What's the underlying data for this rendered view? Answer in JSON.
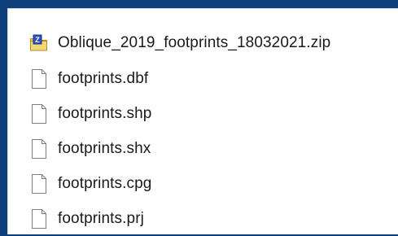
{
  "files": [
    {
      "name": "Oblique_2019_footprints_18032021.zip",
      "icon": "zip-folder-icon"
    },
    {
      "name": "footprints.dbf",
      "icon": "document-icon"
    },
    {
      "name": "footprints.shp",
      "icon": "document-icon"
    },
    {
      "name": "footprints.shx",
      "icon": "document-icon"
    },
    {
      "name": "footprints.cpg",
      "icon": "document-icon"
    },
    {
      "name": "footprints.prj",
      "icon": "document-icon"
    }
  ],
  "colors": {
    "background_frame": "#0f3f7a",
    "panel": "#ffffff",
    "text": "#1a1a1a",
    "zip_folder": "#e8c85a",
    "zip_badge": "#2f4fbf"
  }
}
